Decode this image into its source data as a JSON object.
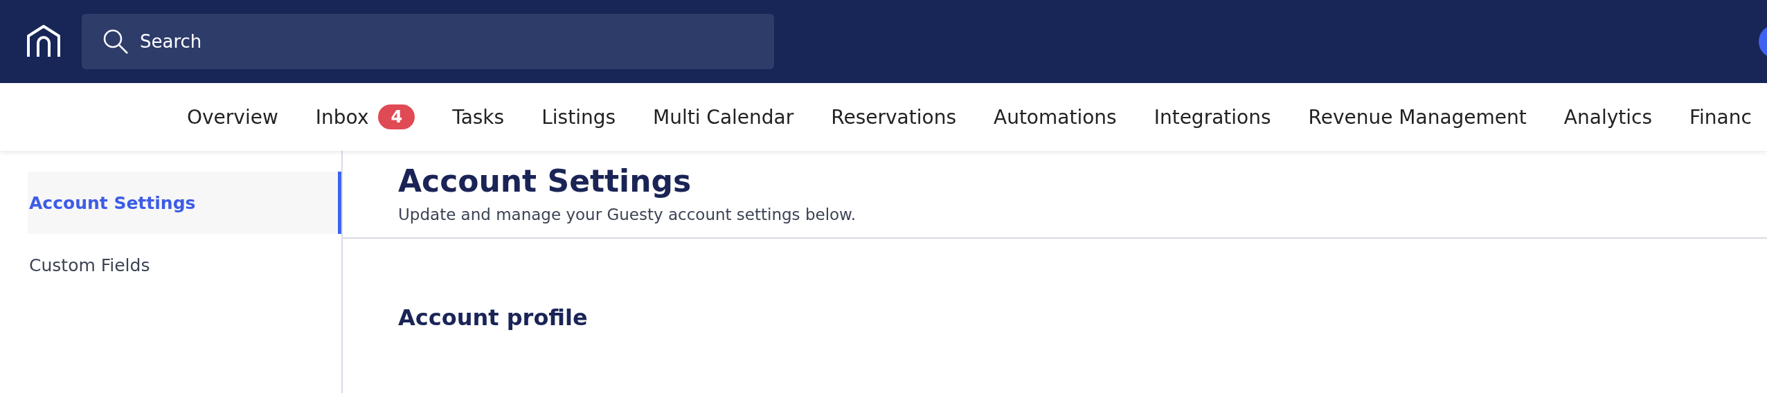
{
  "search": {
    "placeholder": "Search"
  },
  "nav": [
    {
      "label": "Overview"
    },
    {
      "label": "Inbox",
      "badge": "4"
    },
    {
      "label": "Tasks"
    },
    {
      "label": "Listings"
    },
    {
      "label": "Multi Calendar"
    },
    {
      "label": "Reservations"
    },
    {
      "label": "Automations"
    },
    {
      "label": "Integrations"
    },
    {
      "label": "Revenue Management"
    },
    {
      "label": "Analytics"
    },
    {
      "label": "Financ"
    }
  ],
  "sidebar": {
    "items": [
      {
        "label": "Account Settings",
        "selected": true
      },
      {
        "label": "Custom Fields",
        "selected": false
      }
    ]
  },
  "page": {
    "title": "Account Settings",
    "subtitle": "Update and manage your Guesty account settings below.",
    "section_title": "Account profile"
  }
}
